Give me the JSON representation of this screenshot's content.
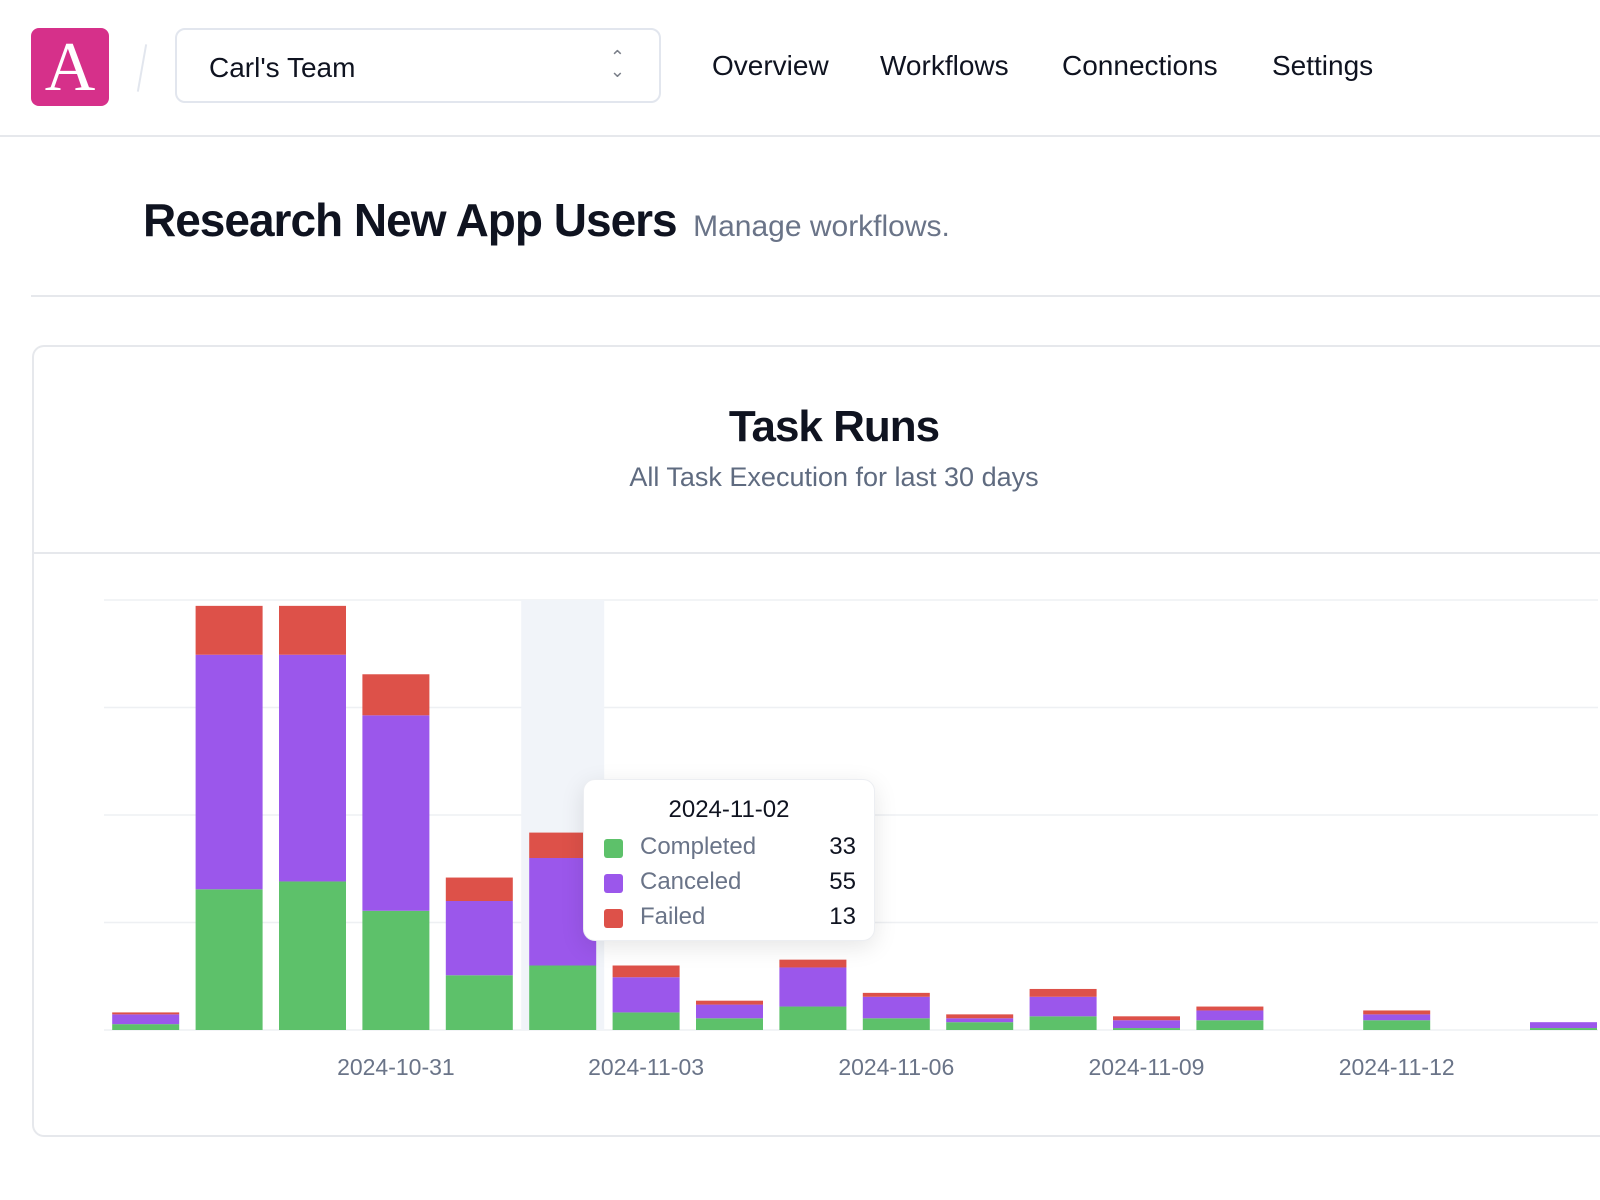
{
  "header": {
    "logo_letter": "A",
    "team": "Carl's Team",
    "nav": [
      "Overview",
      "Workflows",
      "Connections",
      "Settings"
    ]
  },
  "page": {
    "title": "Research New App Users",
    "subtitle": "Manage workflows."
  },
  "card": {
    "title": "Task Runs",
    "subtitle": "All Task Execution for last 30 days"
  },
  "tooltip": {
    "date": "2024-11-02",
    "rows": [
      {
        "label": "Completed",
        "value": "33"
      },
      {
        "label": "Canceled",
        "value": "55"
      },
      {
        "label": "Failed",
        "value": "13"
      }
    ]
  },
  "chart_data": {
    "type": "bar",
    "stacked": true,
    "title": "Task Runs",
    "subtitle": "All Task Execution for last 30 days",
    "categories": [
      "2024-10-28",
      "2024-10-29",
      "2024-10-30",
      "2024-10-31",
      "2024-11-01",
      "2024-11-02",
      "2024-11-03",
      "2024-11-04",
      "2024-11-05",
      "2024-11-06",
      "2024-11-07",
      "2024-11-08",
      "2024-11-09",
      "2024-11-10",
      "2024-11-11",
      "2024-11-12",
      "2024-11-13",
      "2024-11-14"
    ],
    "tick_labels": [
      "2024-10-31",
      "2024-11-03",
      "2024-11-06",
      "2024-11-09",
      "2024-11-12"
    ],
    "series": [
      {
        "name": "Completed",
        "color": "#5dc16a",
        "values": [
          3,
          72,
          76,
          61,
          28,
          33,
          9,
          6,
          12,
          6,
          4,
          7,
          1,
          5,
          0,
          5,
          0,
          1
        ]
      },
      {
        "name": "Canceled",
        "color": "#9b57eb",
        "values": [
          5,
          120,
          116,
          100,
          38,
          55,
          18,
          7,
          20,
          11,
          2,
          10,
          4,
          5,
          0,
          3,
          0,
          3
        ]
      },
      {
        "name": "Failed",
        "color": "#dd5149",
        "values": [
          1,
          25,
          25,
          21,
          12,
          13,
          6,
          2,
          4,
          2,
          2,
          4,
          2,
          2,
          0,
          2,
          0,
          0
        ]
      }
    ],
    "ylim": [
      0,
      220
    ],
    "grid": true,
    "highlighted": "2024-11-02"
  }
}
